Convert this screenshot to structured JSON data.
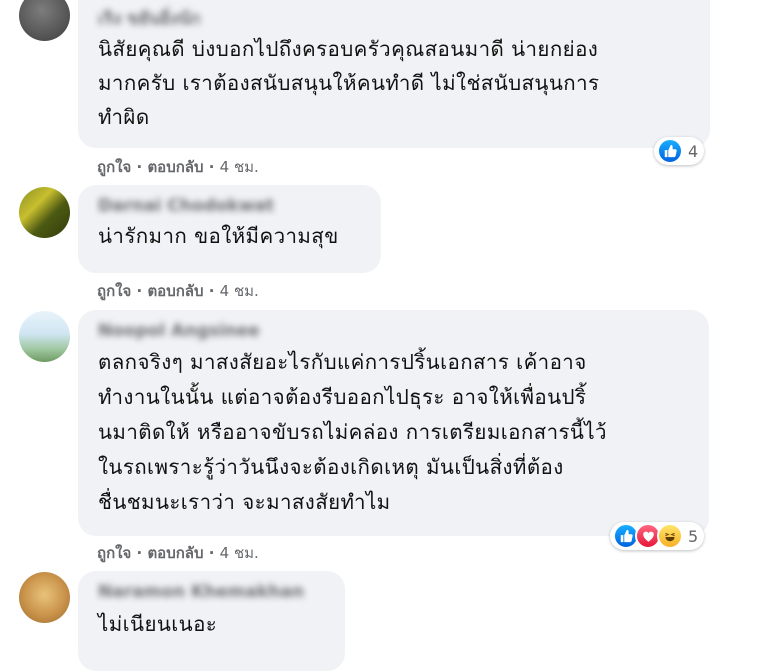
{
  "comments": [
    {
      "author": "เริง ขยันยิ่งนัก",
      "lines": [
        "นิสัยคุณดี บ่งบอกไปถึงครอบครัวคุณสอนมาดี น่ายกย่อง",
        "มากครับ เราต้องสนับสนุนให้คนทำดี ไม่ใช่สนับสนุนการ",
        "ทำผิด"
      ],
      "actions": {
        "like": "ถูกใจ",
        "reply": "ตอบกลับ",
        "time": "4 ชม."
      },
      "reactions": {
        "icons": [
          "like-icon"
        ],
        "count": "4"
      }
    },
    {
      "author": "Darnai Chodokwat",
      "lines": [
        "น่ารักมาก ขอให้มีความสุข"
      ],
      "actions": {
        "like": "ถูกใจ",
        "reply": "ตอบกลับ",
        "time": "4 ชม."
      }
    },
    {
      "author": "Noopol Angsinee",
      "lines": [
        "ตลกจริงๆ มาสงสัยอะไรกับแค่การปริ้นเอกสาร เค้าอาจ",
        "ทำงานในนั้น แต่อาจต้องรีบออกไปธุระ อาจให้เพื่อนปริ้",
        "นมาติดให้ หรืออาจขับรถไม่คล่อง การเตรียมเอกสารนี้ไว้",
        "ในรถเพราะรู้ว่าวันนึงจะต้องเกิดเหตุ มันเป็นสิ่งที่ต้อง",
        "ชื่นชมนะเราว่า จะมาสงสัยทำไม"
      ],
      "actions": {
        "like": "ถูกใจ",
        "reply": "ตอบกลับ",
        "time": "4 ชม."
      },
      "reactions": {
        "icons": [
          "like-icon",
          "love-icon",
          "haha-icon"
        ],
        "count": "5"
      }
    },
    {
      "author": "Naramon Khemakhan",
      "lines": [
        "ไม่เนียนเนอะ"
      ]
    }
  ],
  "colors": {
    "bubble": "#f0f2f5",
    "meta_text": "#65676b",
    "like": "#1877f2",
    "love": "#f33e58",
    "haha": "#f7b125"
  }
}
